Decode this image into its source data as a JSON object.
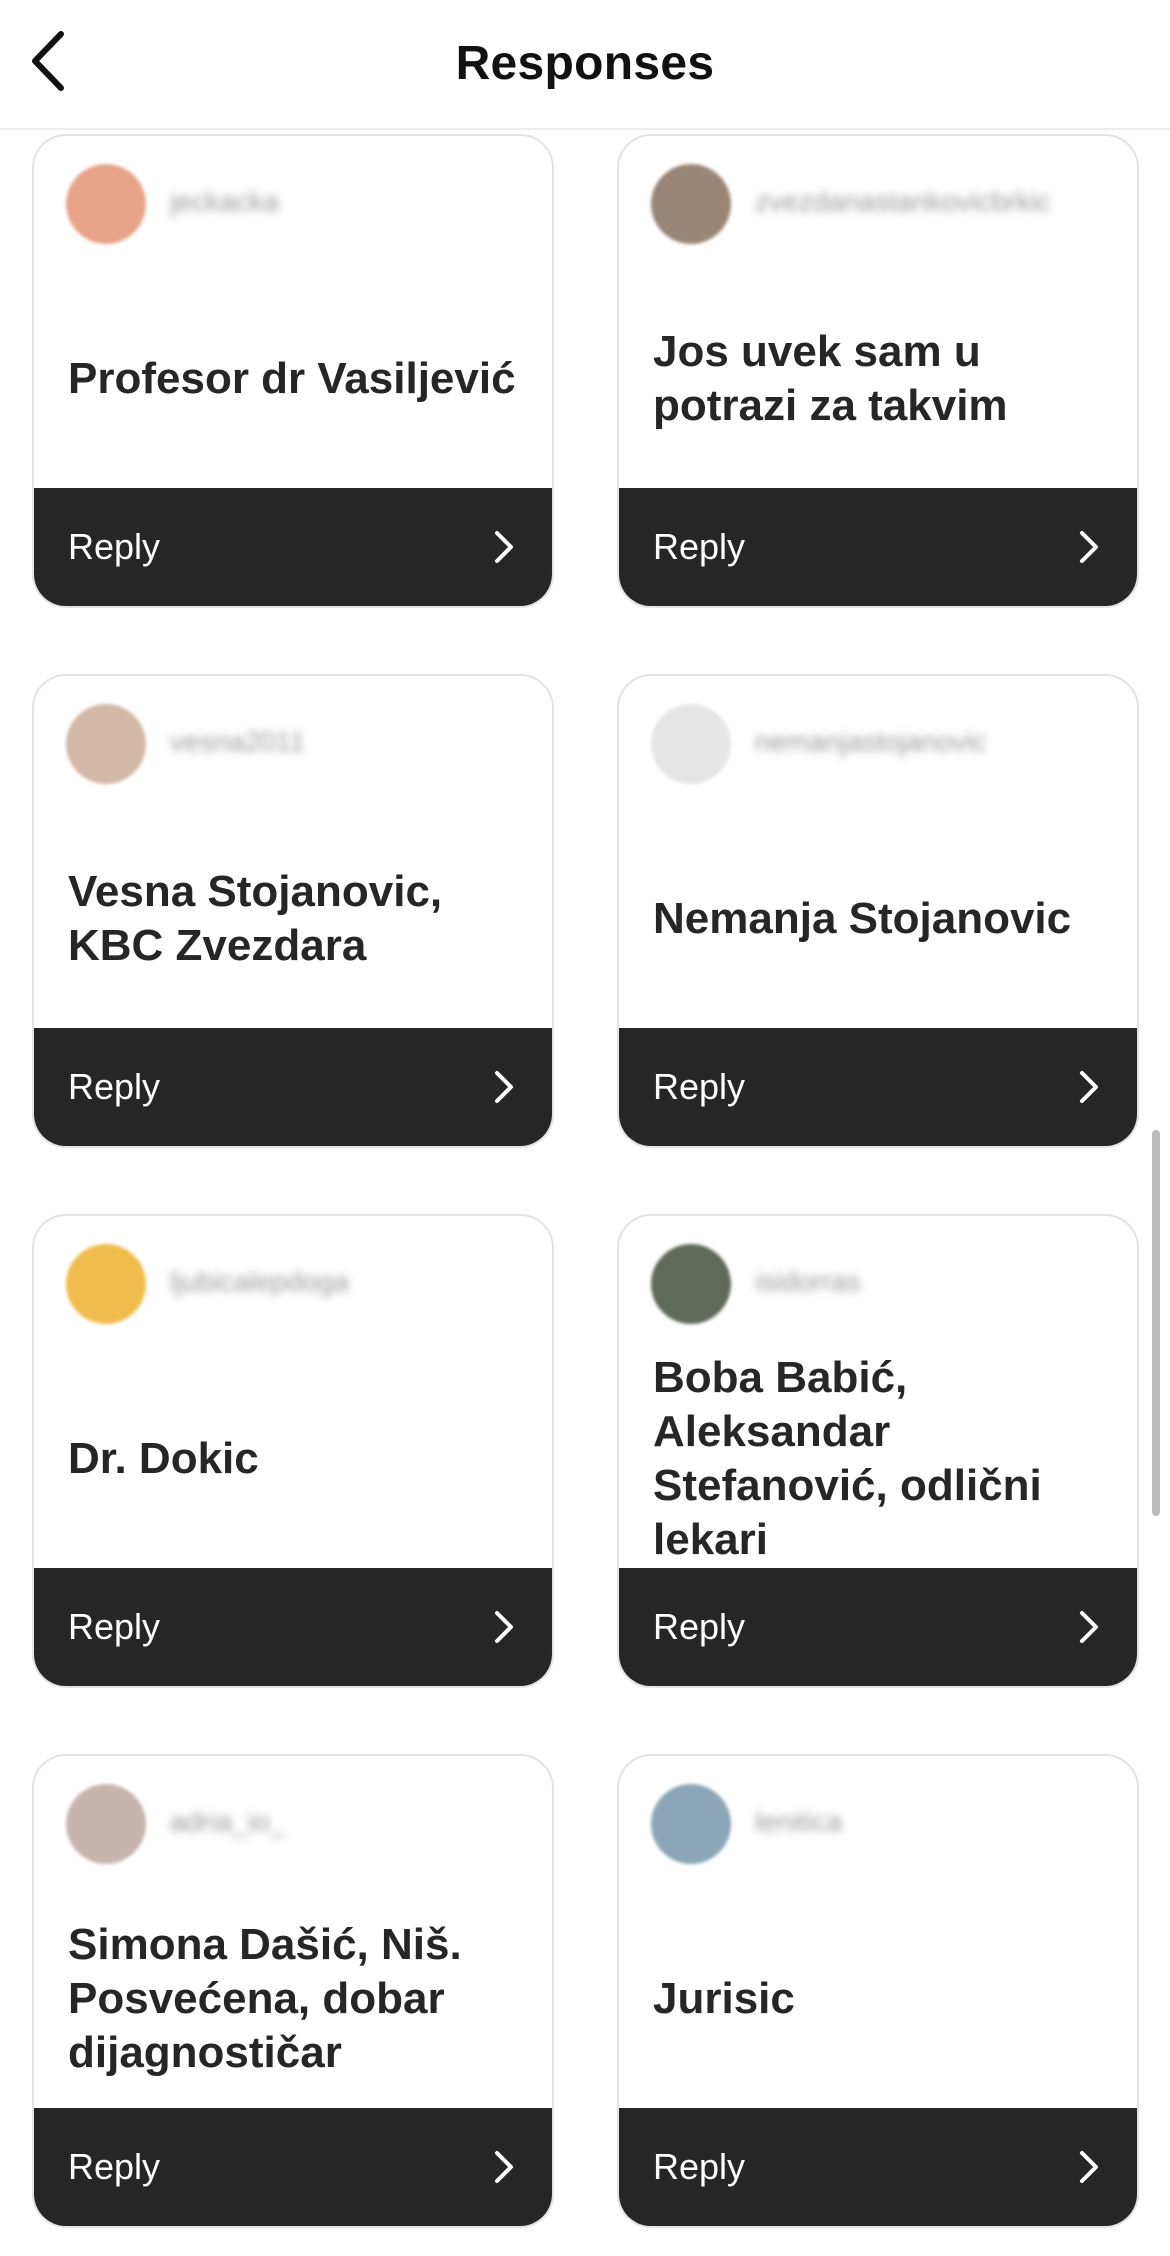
{
  "header": {
    "title": "Responses",
    "back_icon": "chevron-left-icon"
  },
  "reply_label": "Reply",
  "responses": [
    {
      "username": "jeckacka",
      "text": "Profesor dr Vasiljević",
      "avatar_color": "#e8a48a"
    },
    {
      "username": "zvezdanastankovicbrkic",
      "text": "Jos uvek sam u potrazi za takvim",
      "avatar_color": "#9a8676"
    },
    {
      "username": "vesna2011",
      "text": "Vesna Stojanovic, KBC Zvezdara",
      "avatar_color": "#d4b8a6"
    },
    {
      "username": "nemanjastojanovic",
      "text": "Nemanja Stojanovic",
      "avatar_color": "#e6e6e6"
    },
    {
      "username": "ljubicalepdoga",
      "text": "Dr. Dokic",
      "avatar_color": "#f0bc4c"
    },
    {
      "username": "isidorras",
      "text": "Boba Babić, Aleksandar Stefanović, odlični lekari",
      "avatar_color": "#5f6a5a"
    },
    {
      "username": "adria_io_",
      "text": "Simona Dašić, Niš. Posvećena, dobar dijagnostičar",
      "avatar_color": "#c8b4ae"
    },
    {
      "username": "lenitica",
      "text": "Jurisic",
      "avatar_color": "#8aa6b8"
    }
  ]
}
